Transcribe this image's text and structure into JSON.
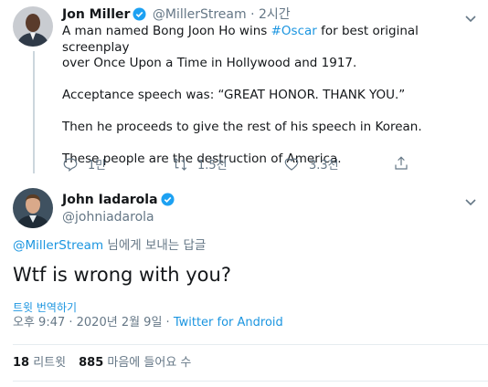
{
  "tweet1": {
    "author_name": "Jon Miller",
    "handle": "@MillerStream",
    "separator": "·",
    "time": "2시간",
    "text_before_hashtag": "A man named Bong Joon Ho wins ",
    "hashtag": "#Oscar",
    "text_after_hashtag": " for best original screenplay",
    "line2": "over Once Upon a Time in Hollywood and 1917.",
    "line3": "Acceptance speech was: “GREAT HONOR. THANK YOU.”",
    "line4": "Then he proceeds to give the rest of his speech in Korean.",
    "line5": "These people are the destruction of America.",
    "reply_count": "1만",
    "retweet_count": "1.5천",
    "like_count": "3.3천"
  },
  "tweet2": {
    "author_name": "John Iadarola",
    "handle": "@johniadarola",
    "reply_to_handle": "@MillerStream",
    "reply_to_suffix": " 님에게 보내는 답글",
    "text": "Wtf is wrong with you?",
    "translate_label": "트윗 번역하기",
    "timestamp": "오후 9:47 · 2020년 2월 9일 · ",
    "source": "Twitter for Android",
    "retweets_count": "18",
    "retweets_label": " 리트윗",
    "likes_count": "885",
    "likes_label": " 마음에 들어요 수"
  },
  "colors": {
    "link": "#1b95e0",
    "secondary_text": "#657786",
    "verified": "#1da1f2",
    "thread_line": "#ccd6dd"
  },
  "icons": [
    "verified-badge-icon",
    "chevron-down-icon",
    "reply-icon",
    "retweet-icon",
    "like-icon",
    "share-icon"
  ]
}
